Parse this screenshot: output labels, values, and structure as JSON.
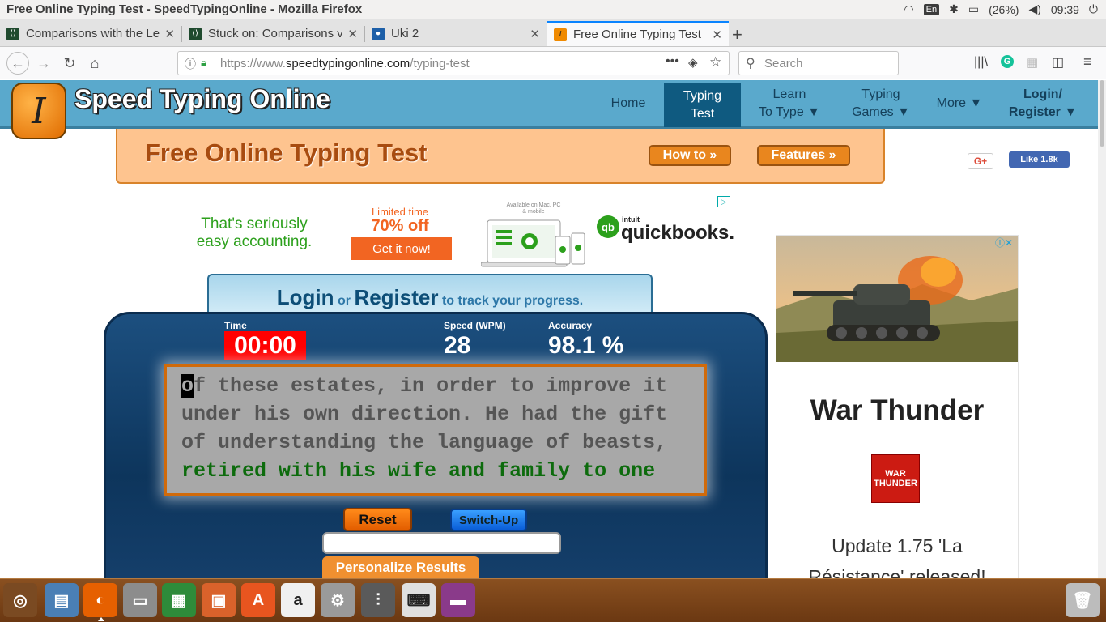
{
  "window": {
    "title": "Free Online Typing Test - SpeedTypingOnline - Mozilla Firefox",
    "lang": "En",
    "battery": "(26%)",
    "clock": "09:39"
  },
  "tabs": [
    {
      "label": "Comparisons with the Le",
      "favicon": "tab-codecademy-icon"
    },
    {
      "label": "Stuck on: Comparisons v",
      "favicon": "tab-codecademy-icon"
    },
    {
      "label": "Uki 2",
      "favicon": "tab-profile-icon"
    },
    {
      "label": "Free Online Typing Test",
      "favicon": "tab-speedtyping-icon"
    }
  ],
  "navbar": {
    "url_prefix": "https://www.",
    "url_host": "speedtypingonline.com",
    "url_path": "/typing-test",
    "search_placeholder": "Search"
  },
  "site": {
    "logo_letter": "I",
    "logo_text": "Speed Typing Online",
    "menu": [
      {
        "line1": "Home",
        "line2": ""
      },
      {
        "line1": "Typing",
        "line2": "Test"
      },
      {
        "line1": "Learn",
        "line2": "To Type ▼"
      },
      {
        "line1": "Typing",
        "line2": "Games ▼"
      },
      {
        "line1": "More ▼",
        "line2": ""
      },
      {
        "line1": "Login/",
        "line2": "Register ▼"
      }
    ],
    "banner_title": "Free Online Typing Test",
    "how_to": "How to »",
    "features": "Features »",
    "gplus": "G+",
    "fb_like": "Like 1.8k"
  },
  "ad_qb": {
    "tagline_1": "That's seriously",
    "tagline_2": "easy accounting.",
    "limited": "Limited time",
    "off": "70% off",
    "cta": "Get it now!",
    "devices_caption": "Available on Mac, PC & mobile",
    "brand_small": "intuit",
    "brand": "quickbooks."
  },
  "login": {
    "login": "Login",
    "or": "or",
    "register": "Register",
    "suffix": "to track your progress."
  },
  "test": {
    "time_label": "Time",
    "time_value": "00:00",
    "speed_label": "Speed (WPM)",
    "speed_value": "28",
    "accuracy_label": "Accuracy",
    "accuracy_value": "98.1 %",
    "caret_char": "o",
    "line1_rest": "f these estates, in order to improve it",
    "line2": "under his own direction. He had the gift",
    "line3": "of understanding the language of beasts,",
    "line4": "retired with his wife and family to one",
    "reset": "Reset",
    "switch_up": "Switch-Up",
    "personalize": "Personalize Results"
  },
  "ad_wt": {
    "title": "War Thunder",
    "logo_text": "WAR THUNDER",
    "update_1": "Update 1.75 'La",
    "update_2": "Résistance' released!"
  },
  "dock": [
    {
      "name": "ubuntu-dash-icon",
      "color": "#7a4a22"
    },
    {
      "name": "image-viewer-icon",
      "color": "#4a7fb5"
    },
    {
      "name": "firefox-icon",
      "color": "#e66000"
    },
    {
      "name": "files-icon",
      "color": "#8c8c8c"
    },
    {
      "name": "spreadsheet-icon",
      "color": "#2e8b3a"
    },
    {
      "name": "presentation-icon",
      "color": "#d9622b"
    },
    {
      "name": "software-center-icon",
      "color": "#e8551f"
    },
    {
      "name": "amazon-icon",
      "color": "#f0f0f0"
    },
    {
      "name": "settings-icon",
      "color": "#9a9a9a"
    },
    {
      "name": "mixer-icon",
      "color": "#5a5a5a"
    },
    {
      "name": "keyboard-icon",
      "color": "#e0e0e0"
    },
    {
      "name": "workspace-icon",
      "color": "#8a3a8a"
    },
    {
      "name": "trash-icon",
      "color": "#bcbcbc"
    }
  ]
}
